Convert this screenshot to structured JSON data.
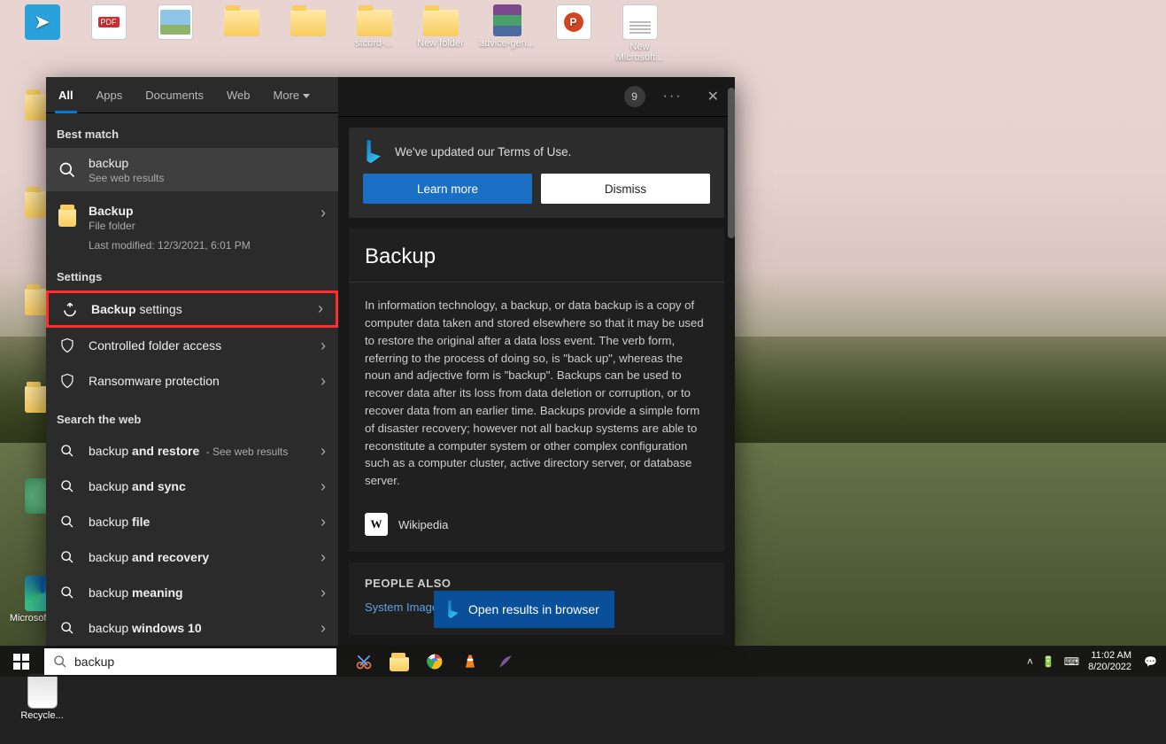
{
  "desktop_icons_row1": [
    {
      "name": "telegram",
      "label": ""
    },
    {
      "name": "pdf",
      "label": ""
    },
    {
      "name": "picture",
      "label": ""
    },
    {
      "name": "folder",
      "label": ""
    },
    {
      "name": "folder",
      "label": ""
    },
    {
      "name": "folder",
      "label": "stcord-..."
    },
    {
      "name": "folder",
      "label": "New folder"
    },
    {
      "name": "winrar",
      "label": "advice-gen..."
    },
    {
      "name": "ppt",
      "label": ""
    },
    {
      "name": "txt",
      "label": "New Microsoft..."
    }
  ],
  "left_desktop_icons": [
    {
      "name": "folder",
      "label": ""
    },
    {
      "name": "folder",
      "label": ""
    },
    {
      "name": "folder",
      "label": ""
    },
    {
      "name": "folder",
      "label": ""
    },
    {
      "name": "atom",
      "label": ""
    },
    {
      "name": "edge",
      "label": "Microsoft Edge"
    },
    {
      "name": "bin",
      "label": "Recycle..."
    }
  ],
  "tabs": {
    "all": "All",
    "apps": "Apps",
    "documents": "Documents",
    "web": "Web",
    "more": "More"
  },
  "header_badge": "9",
  "best_match_label": "Best match",
  "best_match": {
    "title": "backup",
    "sub": "See web results"
  },
  "folder_result": {
    "title": "Backup",
    "sub": "File folder",
    "meta": "Last modified: 12/3/2021, 6:01 PM"
  },
  "settings_label": "Settings",
  "settings_items": [
    {
      "prefix": "Backup",
      "rest": " settings",
      "highlight": true,
      "icon": "restore"
    },
    {
      "prefix": "",
      "rest": "Controlled folder access",
      "icon": "shield"
    },
    {
      "prefix": "",
      "rest": "Ransomware protection",
      "icon": "shield"
    }
  ],
  "web_label": "Search the web",
  "web_items": [
    {
      "pre": "backup ",
      "bold": "and restore",
      "suffix": " - See web results"
    },
    {
      "pre": "backup ",
      "bold": "and sync",
      "suffix": ""
    },
    {
      "pre": "backup ",
      "bold": "file",
      "suffix": ""
    },
    {
      "pre": "backup ",
      "bold": "and recovery",
      "suffix": ""
    },
    {
      "pre": "backup ",
      "bold": "meaning",
      "suffix": ""
    },
    {
      "pre": "backup ",
      "bold": "windows 10",
      "suffix": ""
    }
  ],
  "notice": {
    "text": "We've updated our Terms of Use.",
    "learn": "Learn more",
    "dismiss": "Dismiss"
  },
  "preview": {
    "title": "Backup",
    "body": "In information technology, a backup, or data backup is a copy of computer data taken and stored elsewhere so that it may be used to restore the original after a data loss event. The verb form, referring to the process of doing so, is \"back up\", whereas the noun and adjective form is \"backup\". Backups can be used to recover data after its loss from data deletion or corruption, or to recover data from an earlier time. Backups provide a simple form of disaster recovery; however not all backup systems are able to reconstitute a computer system or other complex configuration such as a computer cluster, active directory server, or database server.",
    "wiki": "Wikipedia",
    "people": "PEOPLE ALSO",
    "link": "System Image",
    "open": "Open results in browser"
  },
  "search": {
    "value": "backup",
    "placeholder": ""
  },
  "clock": {
    "time": "11:02 AM",
    "date": "8/20/2022"
  }
}
